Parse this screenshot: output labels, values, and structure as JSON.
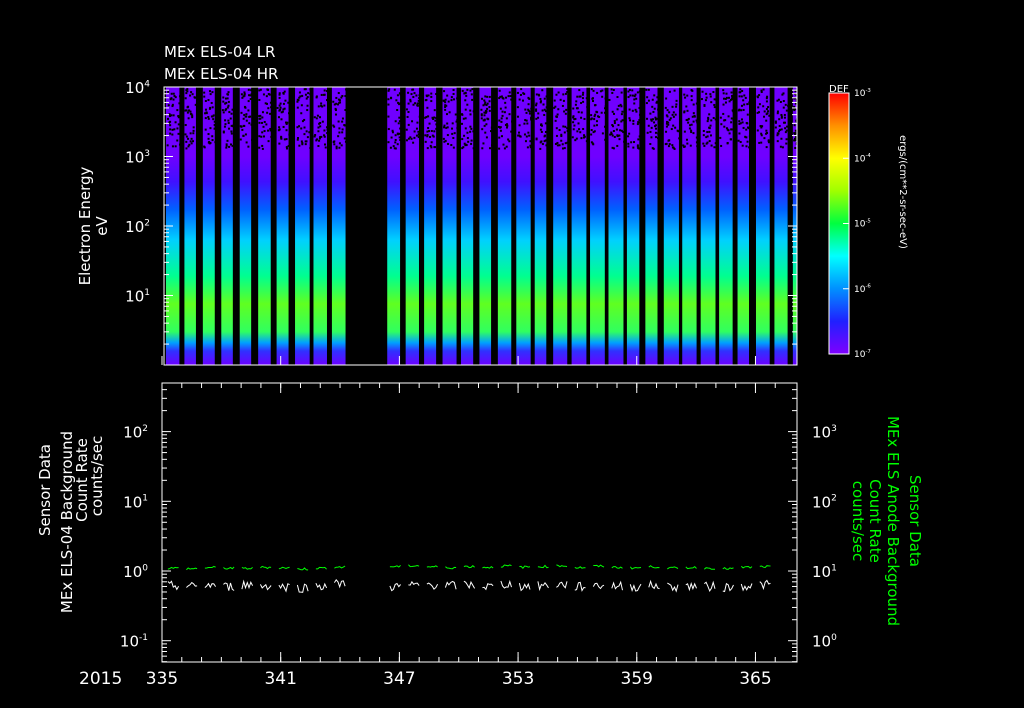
{
  "titles": [
    "MEx ELS-04 LR",
    "MEx ELS-04 HR"
  ],
  "chart_data": [
    {
      "type": "heatmap",
      "title": "MEx ELS-04 LR / MEx ELS-04 HR",
      "ylabel": [
        "Electron Energy",
        "eV"
      ],
      "yscale": "log",
      "ylim": [
        1,
        10000
      ],
      "yticks": [
        {
          "v": 10000,
          "base": "10",
          "exp": "4"
        },
        {
          "v": 1000,
          "base": "10",
          "exp": "3"
        },
        {
          "v": 100,
          "base": "10",
          "exp": "2"
        },
        {
          "v": 10,
          "base": "10",
          "exp": "1"
        }
      ],
      "xlim": [
        335,
        367.1
      ],
      "colorbar": {
        "label": "DEF",
        "units": "ergs/(cm**2-sr-sec-eV)",
        "range": [
          1e-07,
          0.001
        ],
        "ticks": [
          {
            "base": "10",
            "exp": "-3"
          },
          {
            "base": "10",
            "exp": "-4"
          },
          {
            "base": "10",
            "exp": "-5"
          },
          {
            "base": "10",
            "exp": "-6"
          },
          {
            "base": "10",
            "exp": "-7"
          }
        ],
        "colors": [
          "#7f00ff",
          "#2020ff",
          "#0090ff",
          "#00ffff",
          "#00ff40",
          "#a0ff00",
          "#ffff00",
          "#ff9000",
          "#ff0000"
        ]
      },
      "orbit_period_days": 0.935,
      "data_gap_days": [
        [
          344.7,
          345.9
        ]
      ]
    },
    {
      "type": "line",
      "ylabel_left": [
        "MEx ELS-04 Background",
        "Sensor Data",
        "Count Rate",
        "counts/sec"
      ],
      "ylabel_right": [
        "MEx ELS Anode Background",
        "Sensor Data",
        "Count Rate",
        "counts/sec"
      ],
      "yscale": "log",
      "ylim_left": [
        0.047,
        500
      ],
      "ylim_right": [
        0.47,
        5000
      ],
      "yticks_left": [
        {
          "v": 100,
          "base": "10",
          "exp": "2"
        },
        {
          "v": 10,
          "base": "10",
          "exp": "1"
        },
        {
          "v": 1,
          "base": "10",
          "exp": "0"
        },
        {
          "v": 0.1,
          "base": "10",
          "exp": "-1"
        }
      ],
      "yticks_right": [
        {
          "v": 1000,
          "base": "10",
          "exp": "3"
        },
        {
          "v": 100,
          "base": "10",
          "exp": "2"
        },
        {
          "v": 10,
          "base": "10",
          "exp": "1"
        },
        {
          "v": 1,
          "base": "10",
          "exp": "0"
        }
      ],
      "year_label": "2015",
      "xticks": [
        "335",
        "341",
        "347",
        "353",
        "359",
        "365"
      ],
      "xtick_values": [
        335,
        341,
        347,
        353,
        359,
        365
      ],
      "xlim": [
        335,
        367.1
      ],
      "series": [
        {
          "name": "MEx ELS Anode Background (right axis)",
          "color": "#00ff00",
          "typical": 11,
          "values": [
            11,
            10.8,
            11.2,
            11,
            10.9,
            11.3,
            11.1,
            10.7,
            11,
            11.4,
            11.8,
            12.5,
            11.6,
            11.9,
            11.5,
            11.2,
            11.6,
            11.3,
            11.8,
            11.4,
            11.6,
            11.9,
            11.2,
            11.7,
            11.3,
            11.1,
            11.5,
            11,
            11.2,
            11,
            10.8,
            11.3,
            11.5
          ]
        },
        {
          "name": "MEx ELS-04 Background (left axis)",
          "color": "#ffffff",
          "typical": 0.6,
          "values": [
            0.62,
            0.6,
            0.63,
            0.6,
            0.64,
            0.62,
            0.6,
            0.58,
            0.62,
            0.66,
            0.6,
            0.68,
            0.6,
            0.62,
            0.64,
            0.62,
            0.63,
            0.6,
            0.65,
            0.61,
            0.62,
            0.64,
            0.6,
            0.63,
            0.61,
            0.6,
            0.62,
            0.6,
            0.61,
            0.6,
            0.59,
            0.62,
            0.64
          ]
        }
      ]
    }
  ]
}
